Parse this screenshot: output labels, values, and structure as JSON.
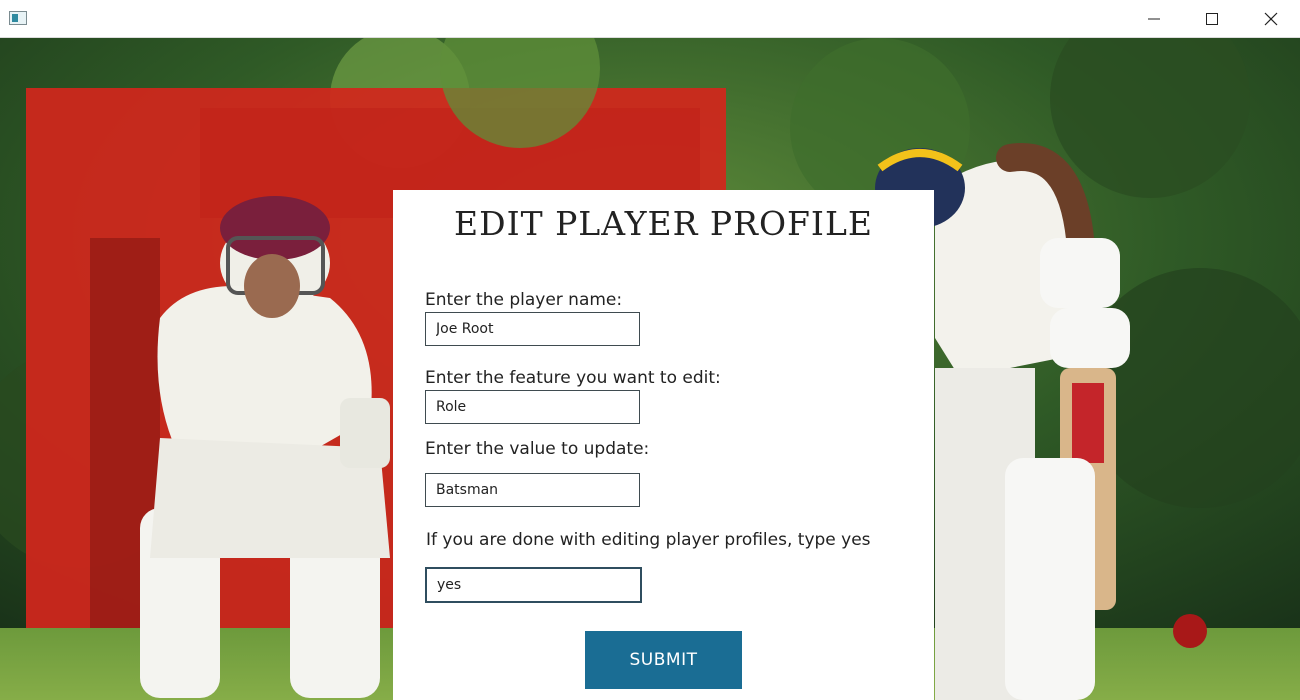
{
  "window": {
    "controls": {
      "minimize": "minimize-icon",
      "maximize": "maximize-icon",
      "close": "close-icon"
    }
  },
  "form": {
    "title": "EDIT PLAYER PROFILE",
    "fields": [
      {
        "label": "Enter the player name:",
        "value": "Joe Root"
      },
      {
        "label": "Enter the feature you want to edit:",
        "value": "Role"
      },
      {
        "label": "Enter the value to update:",
        "value": "Batsman"
      },
      {
        "label": "If you are done with editing player profiles, type yes",
        "value": "yes"
      }
    ],
    "submit_label": "SUBMIT"
  },
  "colors": {
    "accent": "#1a6d94",
    "card": "#ffffff",
    "grass": "#4e7a2c"
  }
}
